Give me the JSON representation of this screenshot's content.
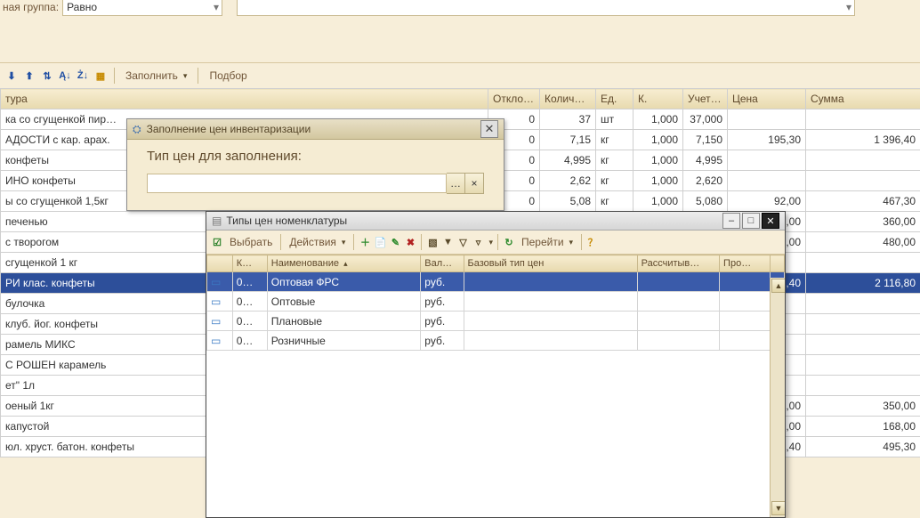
{
  "topFilter": {
    "label": "ная группа:",
    "operator": "Равно"
  },
  "mainToolbar": {
    "fill": "Заполнить",
    "pick": "Подбор"
  },
  "mainTable": {
    "headers": {
      "name": "тура",
      "otk": "Отклон…",
      "qty": "Количе…",
      "unit": "Ед.",
      "k": "К.",
      "uchet": "Учет…",
      "price": "Цена",
      "sum": "Сумма"
    },
    "rows": [
      {
        "name": "ка со сгущенкой пир…",
        "otk": "0",
        "qty": "37",
        "unit": "шт",
        "k": "1,000",
        "uchet": "37,000",
        "price": "",
        "sum": ""
      },
      {
        "name": "АДОСТИ с кар. арах.",
        "otk": "0",
        "qty": "7,15",
        "unit": "кг",
        "k": "1,000",
        "uchet": "7,150",
        "price": "195,30",
        "sum": "1 396,40"
      },
      {
        "name": " конфеты",
        "otk": "0",
        "qty": "4,995",
        "unit": "кг",
        "k": "1,000",
        "uchet": "4,995",
        "price": "",
        "sum": ""
      },
      {
        "name": "ИНО конфеты",
        "otk": "0",
        "qty": "2,62",
        "unit": "кг",
        "k": "1,000",
        "uchet": "2,620",
        "price": "",
        "sum": ""
      },
      {
        "name": "ы со сгущенкой 1,5кг",
        "otk": "0",
        "qty": "5,08",
        "unit": "кг",
        "k": "1,000",
        "uchet": "5,080",
        "price": "92,00",
        "sum": "467,30"
      },
      {
        "name": " печенью",
        "otk": "",
        "qty": "",
        "unit": "",
        "k": "",
        "uchet": "",
        "price": "12,00",
        "sum": "360,00"
      },
      {
        "name": " с творогом",
        "otk": "",
        "qty": "",
        "unit": "",
        "k": "",
        "uchet": "",
        "price": "8,00",
        "sum": "480,00"
      },
      {
        "name": "сгущенкой 1 кг",
        "otk": "",
        "qty": "",
        "unit": "",
        "k": "",
        "uchet": "",
        "price": "",
        "sum": ""
      },
      {
        "name": "РИ клас. конфеты",
        "otk": "",
        "qty": "",
        "unit": "",
        "k": "",
        "uchet": "",
        "price": "176,40",
        "sum": "2 116,80",
        "selected": true
      },
      {
        "name": " булочка",
        "otk": "",
        "qty": "",
        "unit": "",
        "k": "",
        "uchet": "",
        "price": "",
        "sum": ""
      },
      {
        "name": "клуб. йог. конфеты",
        "otk": "",
        "qty": "",
        "unit": "",
        "k": "",
        "uchet": "",
        "price": "",
        "sum": ""
      },
      {
        "name": "рамель МИКС",
        "otk": "",
        "qty": "",
        "unit": "",
        "k": "",
        "uchet": "",
        "price": "",
        "sum": ""
      },
      {
        "name": "С РОШЕН карамель",
        "otk": "",
        "qty": "",
        "unit": "",
        "k": "",
        "uchet": "",
        "price": "",
        "sum": ""
      },
      {
        "name": "ет\" 1л",
        "otk": "",
        "qty": "",
        "unit": "",
        "k": "",
        "uchet": "",
        "price": "",
        "sum": ""
      },
      {
        "name": "оеный 1кг",
        "otk": "",
        "qty": "",
        "unit": "",
        "k": "",
        "uchet": "",
        "price": "70,00",
        "sum": "350,00"
      },
      {
        "name": "капустой",
        "otk": "",
        "qty": "",
        "unit": "",
        "k": "",
        "uchet": "",
        "price": "12,00",
        "sum": "168,00"
      },
      {
        "name": "юл. хруст. батон. конфеты",
        "otk": "",
        "qty": "",
        "unit": "",
        "k": "",
        "uchet": "",
        "price": "230,40",
        "sum": "495,30"
      }
    ]
  },
  "modal1": {
    "title": "Заполнение цен инвентаризации",
    "label": "Тип цен для заполнения:",
    "ellipsis": "…",
    "clear": "×"
  },
  "modal2": {
    "title": "Типы цен номенклатуры",
    "toolbar": {
      "select": "Выбрать",
      "actions": "Действия",
      "goto": "Перейти"
    },
    "headers": {
      "icon": "",
      "code": "К…",
      "name": "Наименование",
      "currency": "Вал…",
      "baseType": "Базовый тип цен",
      "calc": "Рассчитыв…",
      "proc": "Про…"
    },
    "rows": [
      {
        "code": "0…",
        "name": "Оптовая ФРС",
        "currency": "руб.",
        "selected": true
      },
      {
        "code": "0…",
        "name": "Оптовые",
        "currency": "руб."
      },
      {
        "code": "0…",
        "name": "Плановые",
        "currency": "руб."
      },
      {
        "code": "0…",
        "name": "Розничные",
        "currency": "руб."
      }
    ]
  }
}
